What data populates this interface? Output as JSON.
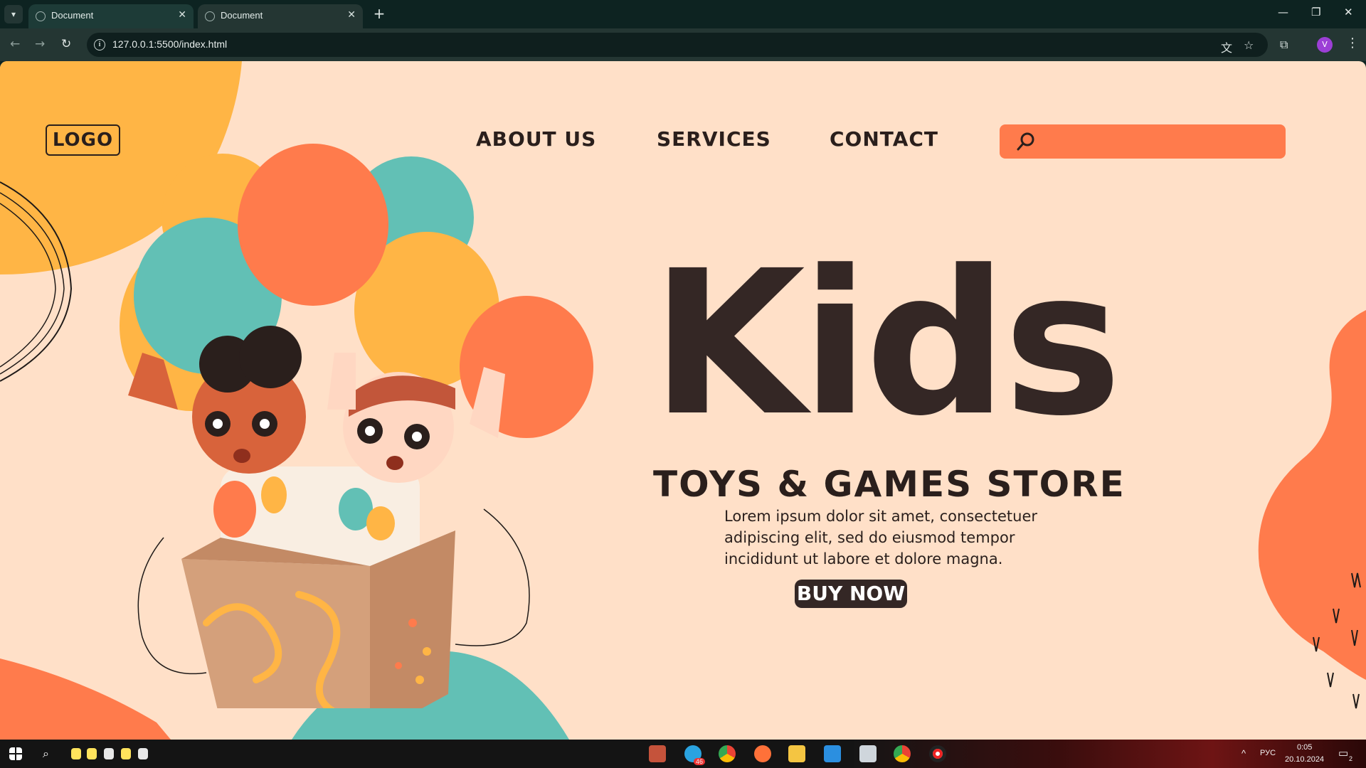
{
  "browser": {
    "tabs": [
      {
        "title": "Document",
        "active": false
      },
      {
        "title": "Document",
        "active": true
      }
    ],
    "url": "127.0.0.1:5500/index.html",
    "profile_initial": "V"
  },
  "page": {
    "logo": "LOGO",
    "nav": [
      "ABOUT US",
      "SERVICES",
      "CONTACT"
    ],
    "search_placeholder": "",
    "hero_title": "Kids",
    "subtitle": "TOYS & GAMES STORE",
    "description": "Lorem ipsum dolor sit amet, consectetuer adipiscing elit, sed do eiusmod tempor incididunt ut labore et dolore magna.",
    "cta": "BUY NOW",
    "colors": {
      "background": "#ffe0c8",
      "orange": "#ff7b4c",
      "yellow": "#ffb545",
      "teal": "#62c0b5",
      "dark": "#342725"
    }
  },
  "taskbar": {
    "language": "РУС",
    "time": "0:05",
    "date": "20.10.2024",
    "telegram_badge": "46",
    "notifications": "2"
  }
}
